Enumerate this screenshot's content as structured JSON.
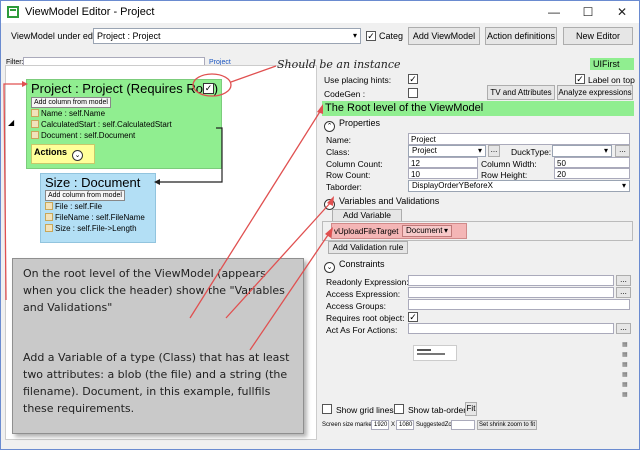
{
  "window": {
    "title": "ViewModel Editor - Project"
  },
  "toolbar": {
    "vm_label": "ViewModel under edit:",
    "vm_value": "Project : Project",
    "categ_label": "Categ",
    "add_vm": "Add ViewModel",
    "action_defs": "Action definitions",
    "new_editor": "New Editor"
  },
  "filter": {
    "label": "Filter:",
    "value": "",
    "hint": "Project"
  },
  "canvas": {
    "root": {
      "title": "Project : Project  (Requires Root)",
      "add_col": "Add column from model",
      "attrs": [
        "Name : self.Name",
        "CalculatedStart : self.CalculatedStart",
        "Document : self.Document"
      ],
      "actions": "Actions"
    },
    "size": {
      "title": "Size : Document",
      "add_col": "Add column from model",
      "attrs": [
        "File : self.File",
        "FileName : self.FileName",
        "Size : self.File->Length"
      ]
    }
  },
  "annotations": {
    "should_instance": "Should be an instance",
    "callout_top": "On the root level of the ViewModel (appears when you click the header) show the \"Variables and Validations\"",
    "callout_bottom": "Add a Variable of a type (Class) that has at least two attributes: a blob (the file) and a string (the filename). Document, in this example, fullfils these requirements."
  },
  "right": {
    "uifirst": "UIFirst",
    "use_placing": "Use placing hints:",
    "codegen": "CodeGen :",
    "label_on_top": "Label on top",
    "tv_attrs": "TV and Attributes",
    "analyze": "Analyze expressions",
    "root_level": "The Root level of the ViewModel",
    "properties": "Properties",
    "name_lbl": "Name:",
    "name_val": "Project",
    "class_lbl": "Class:",
    "class_val": "Project",
    "ducktype_lbl": "DuckType:",
    "colcount_lbl": "Column Count:",
    "colcount_val": "12",
    "colwidth_lbl": "Column Width:",
    "colwidth_val": "50",
    "rowcount_lbl": "Row Count:",
    "rowcount_val": "10",
    "rowheight_lbl": "Row Height:",
    "rowheight_val": "20",
    "taborder_lbl": "Taborder:",
    "taborder_val": "DisplayOrderYBeforeX",
    "vars_val": "Variables and Validations",
    "add_variable": "Add Variable",
    "var_name": "vUploadFileTarget",
    "var_type": "Document",
    "add_validation": "Add Validation rule",
    "constraints": "Constraints",
    "readonly_lbl": "Readonly Expression:",
    "access_lbl": "Access Expression:",
    "access_groups_lbl": "Access Groups:",
    "requires_root_lbl": "Requires root object:",
    "act_as_lbl": "Act As For Actions:",
    "show_grid": "Show grid lines",
    "show_tab": "Show tab-order",
    "fit": "Fit",
    "screen_marker": "Screen size marker",
    "sw": "1920",
    "x": "X",
    "sh": "1080",
    "suggested_zoom": "SuggestedZoom",
    "shrink": "Set shrink zoom to fit",
    "ellipsis": "..."
  }
}
